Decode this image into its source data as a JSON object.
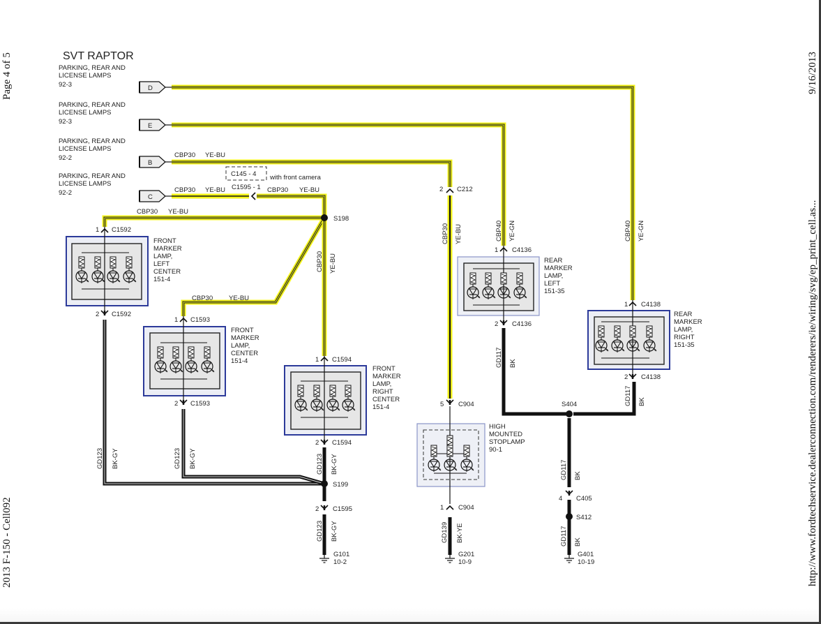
{
  "page_margin": {
    "left_top": "Page 4 of 5",
    "left_bottom": "2013 F-150 - Cell092",
    "right_url": "http://www.fordtechservice.dealerconnection.com/renderers/ie/wiring/svg/ep_print_cell.as...",
    "right_date": "9/16/2013"
  },
  "diagram": {
    "title": "SVT RAPTOR",
    "inputs": [
      {
        "id": "D",
        "desc_line1": "PARKING, REAR AND",
        "desc_line2": "LICENSE LAMPS",
        "ref": "92-3"
      },
      {
        "id": "E",
        "desc_line1": "PARKING, REAR AND",
        "desc_line2": "LICENSE LAMPS",
        "ref": "92-3"
      },
      {
        "id": "B",
        "desc_line1": "PARKING, REAR AND",
        "desc_line2": "LICENSE LAMPS",
        "ref": "92-2",
        "circuit": "CBP30",
        "color": "YE-BU"
      },
      {
        "id": "C",
        "desc_line1": "PARKING, REAR AND",
        "desc_line2": "LICENSE LAMPS",
        "ref": "92-2",
        "circuit": "CBP30",
        "color": "YE-BU"
      }
    ],
    "camera_option": {
      "connector": "C145 - 4",
      "note": "with front camera",
      "alt_connector": "C1595 - 1",
      "circuit": "CBP30",
      "color": "YE-BU"
    },
    "splices": {
      "s198": "S198",
      "s199": "S199",
      "s404": "S404",
      "s412": "S412"
    },
    "wire_labels": {
      "cbp30": "CBP30",
      "yebu": "YE-BU",
      "cbp40": "CBP40",
      "yegn": "YE-GN",
      "gd123": "GD123",
      "bkgy": "BK-GY",
      "gd117": "GD117",
      "bk": "BK",
      "gd139": "GD139",
      "bkye": "BK-YE"
    },
    "components": [
      {
        "key": "fml",
        "name_lines": [
          "FRONT",
          "MARKER",
          "LAMP,",
          "LEFT",
          "CENTER"
        ],
        "ref": "151-4",
        "conn_top": {
          "pin": "1",
          "id": "C1592"
        },
        "conn_bottom": {
          "pin": "2",
          "id": "C1592"
        }
      },
      {
        "key": "fmc",
        "name_lines": [
          "FRONT",
          "MARKER",
          "LAMP,",
          "CENTER"
        ],
        "ref": "151-4",
        "conn_top": {
          "pin": "1",
          "id": "C1593"
        },
        "conn_bottom": {
          "pin": "2",
          "id": "C1593"
        }
      },
      {
        "key": "fmr",
        "name_lines": [
          "FRONT",
          "MARKER",
          "LAMP,",
          "RIGHT",
          "CENTER"
        ],
        "ref": "151-4",
        "conn_top": {
          "pin": "1",
          "id": "C1594"
        },
        "conn_bottom": {
          "pin": "2",
          "id": "C1594"
        }
      },
      {
        "key": "hms",
        "name_lines": [
          "HIGH",
          "MOUNTED",
          "STOPLAMP"
        ],
        "ref": "90-1",
        "conn_top": {
          "pin": "5",
          "id": "C904"
        },
        "conn_bottom": {
          "pin": "1",
          "id": "C904"
        }
      },
      {
        "key": "rml",
        "name_lines": [
          "REAR",
          "MARKER",
          "LAMP,",
          "LEFT"
        ],
        "ref": "151-35",
        "conn_top": {
          "pin": "1",
          "id": "C4136"
        },
        "conn_bottom": {
          "pin": "2",
          "id": "C4136"
        }
      },
      {
        "key": "rmr",
        "name_lines": [
          "REAR",
          "MARKER",
          "LAMP,",
          "RIGHT"
        ],
        "ref": "151-35",
        "conn_top": {
          "pin": "1",
          "id": "C4138"
        },
        "conn_bottom": {
          "pin": "2",
          "id": "C4138"
        }
      }
    ],
    "inline_connectors": {
      "c212": {
        "pin": "2",
        "id": "C212"
      },
      "c1595": {
        "pin": "2",
        "id": "C1595"
      },
      "c405": {
        "pin": "4",
        "id": "C405"
      }
    },
    "grounds": [
      {
        "id": "G101",
        "ref": "10-2"
      },
      {
        "id": "G201",
        "ref": "10-9"
      },
      {
        "id": "G401",
        "ref": "10-19"
      }
    ]
  },
  "colors": {
    "wire_yellow": "#f4f41a",
    "wire_black": "#111111",
    "component_border": "#2c3a9a",
    "component_fill": "#eceef5"
  }
}
